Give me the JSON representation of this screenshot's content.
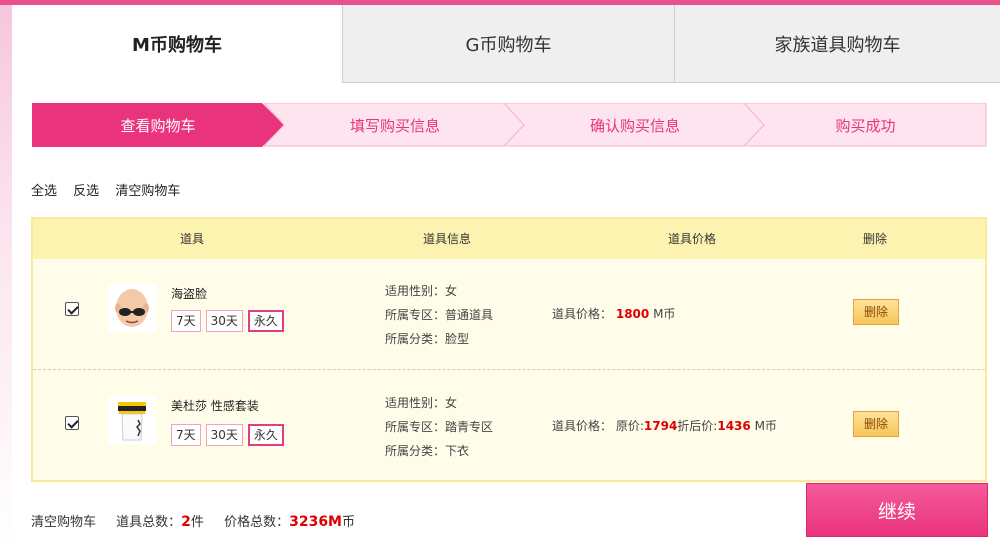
{
  "tabs": [
    {
      "label": "M币购物车",
      "active": true
    },
    {
      "label": "G币购物车",
      "active": false
    },
    {
      "label": "家族道具购物车",
      "active": false
    }
  ],
  "steps": [
    {
      "label": "查看购物车",
      "active": true
    },
    {
      "label": "填写购买信息",
      "active": false
    },
    {
      "label": "确认购买信息",
      "active": false
    },
    {
      "label": "购买成功",
      "active": false
    }
  ],
  "actions": {
    "select_all": "全选",
    "invert": "反选",
    "clear": "清空购物车"
  },
  "table": {
    "headers": {
      "item": "道具",
      "info": "道具信息",
      "price": "道具价格",
      "delete": "删除"
    },
    "rows": [
      {
        "checked": true,
        "name": "海盗脸",
        "durations": [
          "7天",
          "30天",
          "永久"
        ],
        "selected_duration": "永久",
        "gender": "适用性别：女",
        "zone": "所属专区：普通道具",
        "category": "所属分类：脸型",
        "price_label": "道具价格：",
        "price_value": "1800",
        "price_unit": "M币",
        "delete_label": "删除"
      },
      {
        "checked": true,
        "name": "美杜莎 性感套装",
        "durations": [
          "7天",
          "30天",
          "永久"
        ],
        "selected_duration": "永久",
        "gender": "适用性别：女",
        "zone": "所属专区：踏青专区",
        "category": "所属分类：下衣",
        "price_label": "道具价格：",
        "orig_label": "原价:",
        "orig_value": "1794",
        "disc_label": "折后价:",
        "disc_value": "1436",
        "price_unit": "M币",
        "delete_label": "删除"
      }
    ]
  },
  "footer": {
    "clear": "清空购物车",
    "count_label": "道具总数：",
    "count_value": "2",
    "count_unit": "件",
    "total_label": "价格总数：",
    "total_value": "3236M",
    "total_unit": "币",
    "continue_label": "继续"
  },
  "colors": {
    "accent": "#e9337c",
    "step_inactive": "#fde4ee",
    "header": "#fdf3b0",
    "table_bg": "#fffdea"
  }
}
